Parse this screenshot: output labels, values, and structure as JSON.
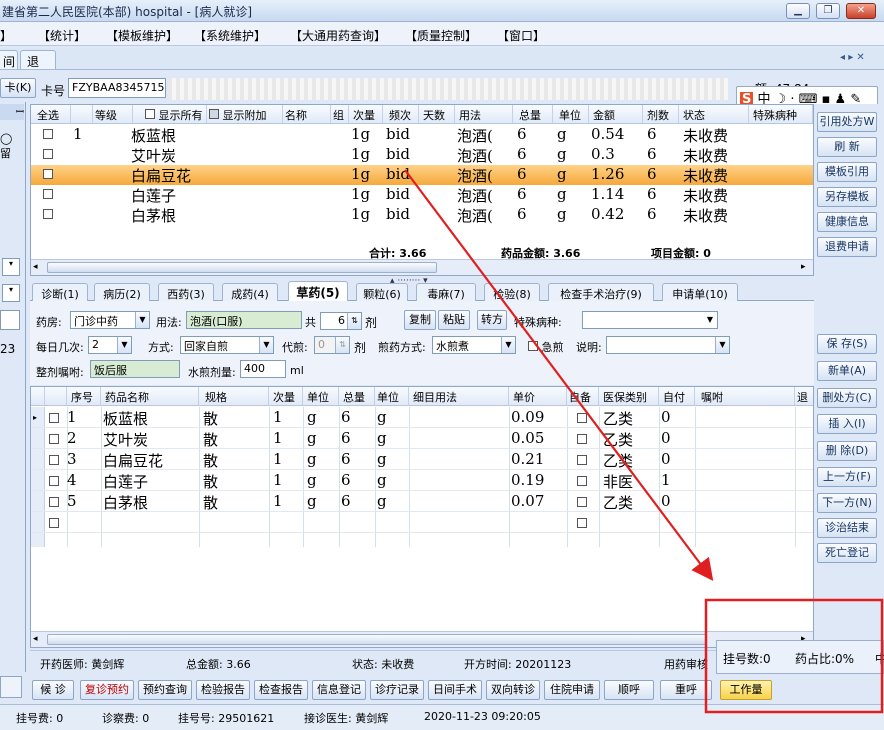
{
  "window": {
    "title": "建省第二人民医院(本部) hospital - [病人就诊]"
  },
  "menu": [
    "【统计】",
    "【模板维护】",
    "【系统维护】",
    "【大通用药查询】",
    "【质量控制】",
    "【窗口】"
  ],
  "tabs": [
    "退号"
  ],
  "patient": {
    "card_label": "卡号",
    "card_no": "FZYBAA8345715",
    "card_btn": "卡(K)",
    "right_partial": "额: 47.84"
  },
  "top_table": {
    "headers": [
      "全选",
      "等级",
      "显示所有",
      "显示附加",
      "名称",
      "组",
      "次量",
      "频次",
      "天数",
      "用法",
      "总量",
      "单位",
      "金额",
      "剂数",
      "状态",
      "特殊病种"
    ],
    "rows": [
      {
        "idx": "1",
        "name": "板蓝根",
        "dose": "1g",
        "freq": "bid",
        "usage": "泡酒(",
        "total": "6",
        "unit": "g",
        "amount": "0.54",
        "qty": "6",
        "status": "未收费"
      },
      {
        "idx": "",
        "name": "艾叶炭",
        "dose": "1g",
        "freq": "bid",
        "usage": "泡酒(",
        "total": "6",
        "unit": "g",
        "amount": "0.3",
        "qty": "6",
        "status": "未收费"
      },
      {
        "idx": "",
        "name": "白扁豆花",
        "dose": "1g",
        "freq": "bid",
        "usage": "泡酒(",
        "total": "6",
        "unit": "g",
        "amount": "1.26",
        "qty": "6",
        "status": "未收费"
      },
      {
        "idx": "",
        "name": "白莲子",
        "dose": "1g",
        "freq": "bid",
        "usage": "泡酒(",
        "total": "6",
        "unit": "g",
        "amount": "1.14",
        "qty": "6",
        "status": "未收费"
      },
      {
        "idx": "",
        "name": "白茅根",
        "dose": "1g",
        "freq": "bid",
        "usage": "泡酒(",
        "total": "6",
        "unit": "g",
        "amount": "0.42",
        "qty": "6",
        "status": "未收费"
      }
    ],
    "footer": {
      "sum": "合计: 3.66",
      "drug_amount": "药品金额: 3.66",
      "item_amount": "项目金额: 0"
    }
  },
  "right_buttons_top": [
    "引用处方W",
    "刷 新",
    "模板引用",
    "另存模板",
    "健康信息",
    "退费申请"
  ],
  "right_buttons_bottom": [
    "保 存(S)",
    "新单(A)",
    "删处方(C)",
    "插 入(I)",
    "删 除(D)",
    "上一方(F)",
    "下一方(N)",
    "诊治结束",
    "死亡登记"
  ],
  "bottom_tabs": [
    "诊断(1)",
    "病历(2)",
    "西药(3)",
    "成药(4)",
    "草药(5)",
    "颗粒(6)",
    "毒麻(7)",
    "检验(8)",
    "检查手术治疗(9)",
    "申请单(10)"
  ],
  "form": {
    "pharmacy_label": "药房:",
    "pharmacy": "门诊中药",
    "usage_label": "用法:",
    "usage": "泡酒(口服)",
    "total_label": "共",
    "total": "6",
    "dose_unit": "剂",
    "copy": "复制",
    "paste": "粘贴",
    "convert": "转方",
    "special_label": "特殊病种:",
    "daily_label": "每日几次:",
    "daily": "2",
    "method_label": "方式:",
    "method": "回家自煎",
    "decoct_label": "代煎:",
    "decoct": "0",
    "decoct_unit": "剂",
    "decoct_method_label": "煎药方式:",
    "decoct_method": "水煎煮",
    "urgent": "急煎",
    "note_label": "说明:",
    "whole_label": "整剂嘱咐:",
    "whole": "饭后服",
    "water_label": "水煎剂量:",
    "water": "400",
    "water_unit": "ml"
  },
  "herb_table": {
    "headers": [
      "序号",
      "药品名称",
      "规格",
      "次量",
      "单位",
      "总量",
      "单位",
      "细目用法",
      "单价",
      "自备",
      "医保类别",
      "自付",
      "嘱咐",
      "退"
    ],
    "rows": [
      {
        "no": "1",
        "name": "板蓝根",
        "spec": "散",
        "dose": "1",
        "unit": "g",
        "total": "6",
        "tunit": "g",
        "price": "0.09",
        "ins": "乙类",
        "self": "0"
      },
      {
        "no": "2",
        "name": "艾叶炭",
        "spec": "散",
        "dose": "1",
        "unit": "g",
        "total": "6",
        "tunit": "g",
        "price": "0.05",
        "ins": "乙类",
        "self": "0"
      },
      {
        "no": "3",
        "name": "白扁豆花",
        "spec": "散",
        "dose": "1",
        "unit": "g",
        "total": "6",
        "tunit": "g",
        "price": "0.21",
        "ins": "乙类",
        "self": "0"
      },
      {
        "no": "4",
        "name": "白莲子",
        "spec": "散",
        "dose": "1",
        "unit": "g",
        "total": "6",
        "tunit": "g",
        "price": "0.19",
        "ins": "非医",
        "self": "1"
      },
      {
        "no": "5",
        "name": "白茅根",
        "spec": "散",
        "dose": "1",
        "unit": "g",
        "total": "6",
        "tunit": "g",
        "price": "0.07",
        "ins": "乙类",
        "self": "0"
      }
    ]
  },
  "status_line": {
    "doctor": "开药医师: 黄剑辉",
    "total": "总金额: 3.66",
    "state": "状态: 未收费",
    "time": "开方时间: 20201123",
    "audit": "用药审核"
  },
  "bottom_buttons": [
    "候 诊",
    "复诊预约",
    "预约查询",
    "检验报告",
    "检查报告",
    "信息登记",
    "诊疗记录",
    "日间手术",
    "双向转诊",
    "住院申请",
    "顺呼",
    "重呼"
  ],
  "popup": {
    "reg_count": "挂号数:0",
    "drug_ratio": "药占比:0%",
    "trailing": "中",
    "work": "工作量"
  },
  "statusbar": {
    "reg_fee": "挂号费: 0",
    "consult_fee": "诊察费: 0",
    "reg_no": "挂号号: 29501621",
    "doctor": "接诊医生: 黄剑辉",
    "datetime": "2020-11-23 09:20:05"
  }
}
